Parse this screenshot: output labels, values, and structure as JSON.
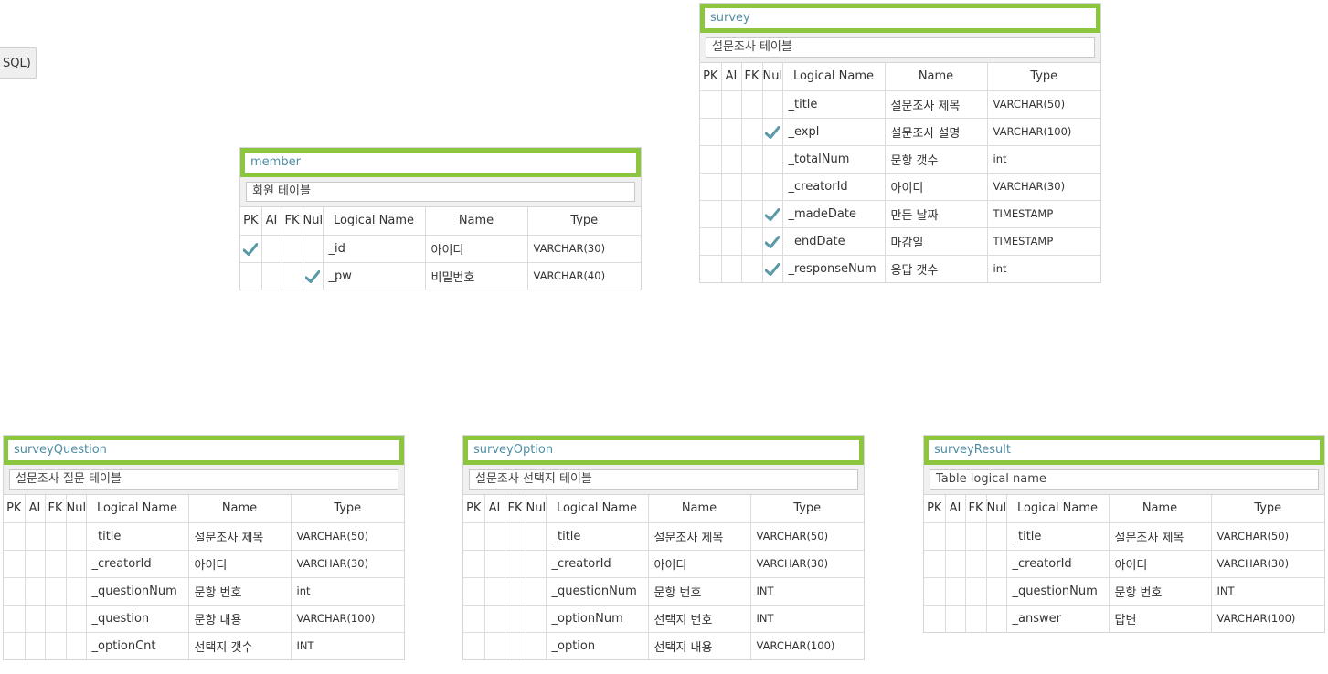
{
  "sql_button": {
    "label": "SQL)"
  },
  "header_labels": {
    "pk": "PK",
    "ai": "AI",
    "fk": "FK",
    "null": "Null",
    "logical": "Logical Name",
    "name": "Name",
    "type": "Type"
  },
  "colors": {
    "accent_border": "#8cc63f",
    "table_name_text": "#4f8ea3",
    "check": "#5a9aa8"
  },
  "tables": [
    {
      "name": "survey",
      "logical": "설문조사 테이블",
      "rows": [
        {
          "pk": false,
          "ai": false,
          "fk": false,
          "null": false,
          "logical": "_title",
          "name": "설문조사 제목",
          "type": "VARCHAR(50)"
        },
        {
          "pk": false,
          "ai": false,
          "fk": false,
          "null": true,
          "logical": "_expl",
          "name": "설문조사 설명",
          "type": "VARCHAR(100)"
        },
        {
          "pk": false,
          "ai": false,
          "fk": false,
          "null": false,
          "logical": "_totalNum",
          "name": "문항 갯수",
          "type": "int"
        },
        {
          "pk": false,
          "ai": false,
          "fk": false,
          "null": false,
          "logical": "_creatorId",
          "name": "아이디",
          "type": "VARCHAR(30)"
        },
        {
          "pk": false,
          "ai": false,
          "fk": false,
          "null": true,
          "logical": "_madeDate",
          "name": "만든 날짜",
          "type": "TIMESTAMP"
        },
        {
          "pk": false,
          "ai": false,
          "fk": false,
          "null": true,
          "logical": "_endDate",
          "name": "마감일",
          "type": "TIMESTAMP"
        },
        {
          "pk": false,
          "ai": false,
          "fk": false,
          "null": true,
          "logical": "_responseNum",
          "name": "응답 갯수",
          "type": "int"
        }
      ]
    },
    {
      "name": "member",
      "logical": "회원 테이블",
      "rows": [
        {
          "pk": true,
          "ai": false,
          "fk": false,
          "null": false,
          "logical": "_id",
          "name": "아이디",
          "type": "VARCHAR(30)"
        },
        {
          "pk": false,
          "ai": false,
          "fk": false,
          "null": true,
          "logical": "_pw",
          "name": "비밀번호",
          "type": "VARCHAR(40)"
        }
      ]
    },
    {
      "name": "surveyQuestion",
      "logical": "설문조사 질문 테이블",
      "rows": [
        {
          "pk": false,
          "ai": false,
          "fk": false,
          "null": false,
          "logical": "_title",
          "name": "설문조사 제목",
          "type": "VARCHAR(50)"
        },
        {
          "pk": false,
          "ai": false,
          "fk": false,
          "null": false,
          "logical": "_creatorId",
          "name": "아이디",
          "type": "VARCHAR(30)"
        },
        {
          "pk": false,
          "ai": false,
          "fk": false,
          "null": false,
          "logical": "_questionNum",
          "name": "문항 번호",
          "type": "int"
        },
        {
          "pk": false,
          "ai": false,
          "fk": false,
          "null": false,
          "logical": "_question",
          "name": "문항 내용",
          "type": "VARCHAR(100)"
        },
        {
          "pk": false,
          "ai": false,
          "fk": false,
          "null": false,
          "logical": "_optionCnt",
          "name": "선택지 갯수",
          "type": "INT"
        }
      ]
    },
    {
      "name": "surveyOption",
      "logical": "설문조사 선택지 테이블",
      "rows": [
        {
          "pk": false,
          "ai": false,
          "fk": false,
          "null": false,
          "logical": "_title",
          "name": "설문조사 제목",
          "type": "VARCHAR(50)"
        },
        {
          "pk": false,
          "ai": false,
          "fk": false,
          "null": false,
          "logical": "_creatorId",
          "name": "아이디",
          "type": "VARCHAR(30)"
        },
        {
          "pk": false,
          "ai": false,
          "fk": false,
          "null": false,
          "logical": "_questionNum",
          "name": "문항 번호",
          "type": "INT"
        },
        {
          "pk": false,
          "ai": false,
          "fk": false,
          "null": false,
          "logical": "_optionNum",
          "name": "선택지 번호",
          "type": "INT"
        },
        {
          "pk": false,
          "ai": false,
          "fk": false,
          "null": false,
          "logical": "_option",
          "name": "선택지 내용",
          "type": "VARCHAR(100)"
        }
      ]
    },
    {
      "name": "surveyResult",
      "logical": "Table logical name",
      "rows": [
        {
          "pk": false,
          "ai": false,
          "fk": false,
          "null": false,
          "logical": "_title",
          "name": "설문조사 제목",
          "type": "VARCHAR(50)"
        },
        {
          "pk": false,
          "ai": false,
          "fk": false,
          "null": false,
          "logical": "_creatorId",
          "name": "아이디",
          "type": "VARCHAR(30)"
        },
        {
          "pk": false,
          "ai": false,
          "fk": false,
          "null": false,
          "logical": "_questionNum",
          "name": "문항 번호",
          "type": "INT"
        },
        {
          "pk": false,
          "ai": false,
          "fk": false,
          "null": false,
          "logical": "_answer",
          "name": "답변",
          "type": "VARCHAR(100)"
        }
      ]
    }
  ]
}
